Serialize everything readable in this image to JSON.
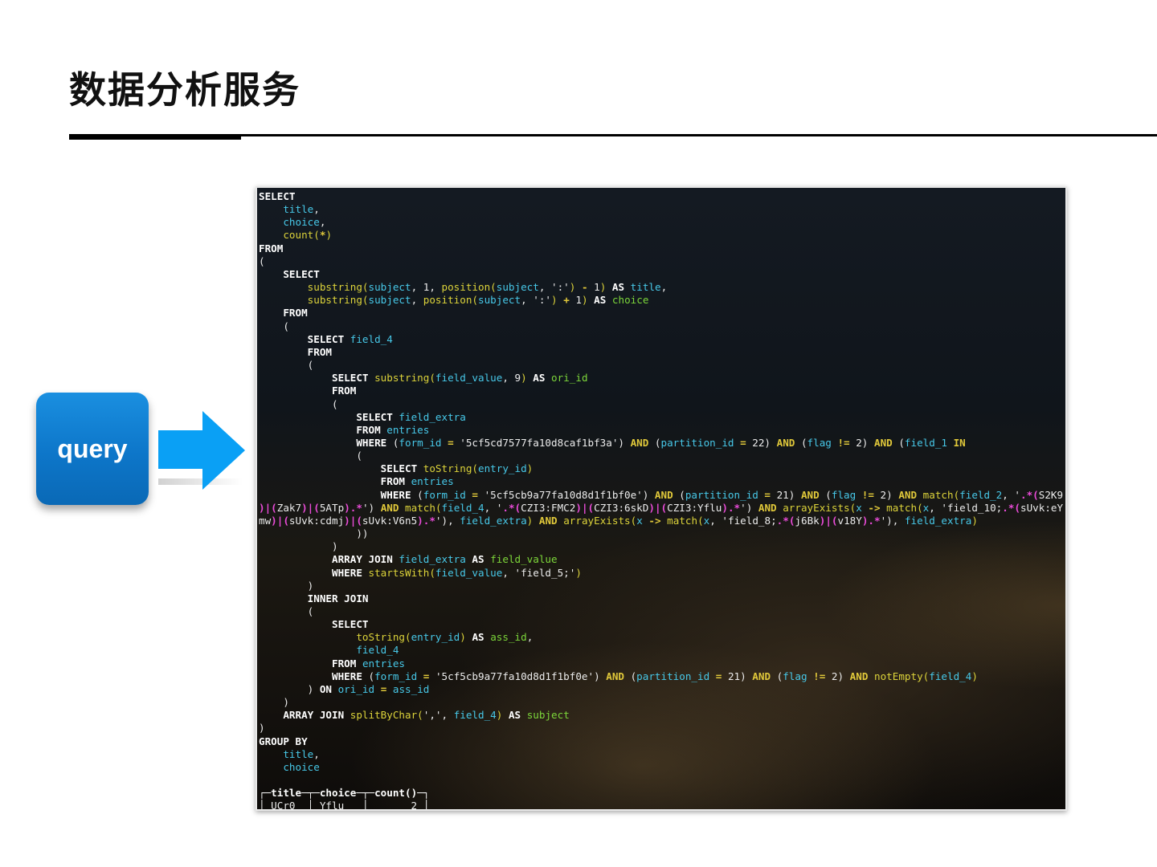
{
  "slide": {
    "title": "数据分析服务"
  },
  "badge": {
    "label": "query",
    "color": "#0d76c9"
  },
  "arrow": {
    "color": "#0aa0f5",
    "direction": "right"
  },
  "terminal": {
    "colors": {
      "keyword": "#ffffff",
      "identifier": "#47c8e8",
      "function": "#dcd33a",
      "alias": "#7cd63a",
      "operator": "#e0c83a",
      "regex": "#ea4bd8"
    },
    "lines": [
      [
        [
          "k",
          "SELECT"
        ]
      ],
      [
        [
          "w",
          "    "
        ],
        [
          "c",
          "title"
        ],
        [
          "w",
          ","
        ]
      ],
      [
        [
          "w",
          "    "
        ],
        [
          "c",
          "choice"
        ],
        [
          "w",
          ","
        ]
      ],
      [
        [
          "w",
          "    "
        ],
        [
          "f",
          "count("
        ],
        [
          "o",
          "*"
        ],
        [
          "f",
          ")"
        ]
      ],
      [
        [
          "k",
          "FROM"
        ]
      ],
      [
        [
          "w",
          "("
        ]
      ],
      [
        [
          "w",
          "    "
        ],
        [
          "k",
          "SELECT"
        ]
      ],
      [
        [
          "w",
          "        "
        ],
        [
          "f",
          "substring("
        ],
        [
          "c",
          "subject"
        ],
        [
          "w",
          ", 1, "
        ],
        [
          "f",
          "position("
        ],
        [
          "c",
          "subject"
        ],
        [
          "w",
          ", ':'"
        ],
        [
          "f",
          ")"
        ],
        [
          "w",
          " "
        ],
        [
          "o",
          "-"
        ],
        [
          "w",
          " 1"
        ],
        [
          "f",
          ")"
        ],
        [
          "w",
          " "
        ],
        [
          "k",
          "AS"
        ],
        [
          "w",
          " "
        ],
        [
          "c",
          "title"
        ],
        [
          "w",
          ","
        ]
      ],
      [
        [
          "w",
          "        "
        ],
        [
          "f",
          "substring("
        ],
        [
          "c",
          "subject"
        ],
        [
          "w",
          ", "
        ],
        [
          "f",
          "position("
        ],
        [
          "c",
          "subject"
        ],
        [
          "w",
          ", ':'"
        ],
        [
          "f",
          ")"
        ],
        [
          "w",
          " "
        ],
        [
          "o",
          "+"
        ],
        [
          "w",
          " 1"
        ],
        [
          "f",
          ")"
        ],
        [
          "w",
          " "
        ],
        [
          "k",
          "AS"
        ],
        [
          "w",
          " "
        ],
        [
          "g",
          "choice"
        ]
      ],
      [
        [
          "w",
          "    "
        ],
        [
          "k",
          "FROM"
        ]
      ],
      [
        [
          "w",
          "    ("
        ]
      ],
      [
        [
          "w",
          "        "
        ],
        [
          "k",
          "SELECT"
        ],
        [
          "w",
          " "
        ],
        [
          "c",
          "field_4"
        ]
      ],
      [
        [
          "w",
          "        "
        ],
        [
          "k",
          "FROM"
        ]
      ],
      [
        [
          "w",
          "        ("
        ]
      ],
      [
        [
          "w",
          "            "
        ],
        [
          "k",
          "SELECT"
        ],
        [
          "w",
          " "
        ],
        [
          "f",
          "substring("
        ],
        [
          "c",
          "field_value"
        ],
        [
          "w",
          ", 9"
        ],
        [
          "f",
          ")"
        ],
        [
          "w",
          " "
        ],
        [
          "k",
          "AS"
        ],
        [
          "w",
          " "
        ],
        [
          "g",
          "ori_id"
        ]
      ],
      [
        [
          "w",
          "            "
        ],
        [
          "k",
          "FROM"
        ]
      ],
      [
        [
          "w",
          "            ("
        ]
      ],
      [
        [
          "w",
          "                "
        ],
        [
          "k",
          "SELECT"
        ],
        [
          "w",
          " "
        ],
        [
          "c",
          "field_extra"
        ]
      ],
      [
        [
          "w",
          "                "
        ],
        [
          "k",
          "FROM"
        ],
        [
          "w",
          " "
        ],
        [
          "c",
          "entries"
        ]
      ],
      [
        [
          "w",
          "                "
        ],
        [
          "k",
          "WHERE"
        ],
        [
          "w",
          " ("
        ],
        [
          "c",
          "form_id"
        ],
        [
          "w",
          " "
        ],
        [
          "o",
          "="
        ],
        [
          "w",
          " '5cf5cd7577fa10d8caf1bf3a') "
        ],
        [
          "o",
          "AND"
        ],
        [
          "w",
          " ("
        ],
        [
          "c",
          "partition_id"
        ],
        [
          "w",
          " "
        ],
        [
          "o",
          "="
        ],
        [
          "w",
          " 22) "
        ],
        [
          "o",
          "AND"
        ],
        [
          "w",
          " ("
        ],
        [
          "c",
          "flag"
        ],
        [
          "w",
          " "
        ],
        [
          "o",
          "!="
        ],
        [
          "w",
          " 2) "
        ],
        [
          "o",
          "AND"
        ],
        [
          "w",
          " ("
        ],
        [
          "c",
          "field_1"
        ],
        [
          "w",
          " "
        ],
        [
          "o",
          "IN"
        ]
      ],
      [
        [
          "w",
          "                ("
        ]
      ],
      [
        [
          "w",
          "                    "
        ],
        [
          "k",
          "SELECT"
        ],
        [
          "w",
          " "
        ],
        [
          "f",
          "toString("
        ],
        [
          "c",
          "entry_id"
        ],
        [
          "f",
          ")"
        ]
      ],
      [
        [
          "w",
          "                    "
        ],
        [
          "k",
          "FROM"
        ],
        [
          "w",
          " "
        ],
        [
          "c",
          "entries"
        ]
      ],
      [
        [
          "w",
          "                    "
        ],
        [
          "k",
          "WHERE"
        ],
        [
          "w",
          " ("
        ],
        [
          "c",
          "form_id"
        ],
        [
          "w",
          " "
        ],
        [
          "o",
          "="
        ],
        [
          "w",
          " '5cf5cb9a77fa10d8d1f1bf0e') "
        ],
        [
          "o",
          "AND"
        ],
        [
          "w",
          " ("
        ],
        [
          "c",
          "partition_id"
        ],
        [
          "w",
          " "
        ],
        [
          "o",
          "="
        ],
        [
          "w",
          " 21) "
        ],
        [
          "o",
          "AND"
        ],
        [
          "w",
          " ("
        ],
        [
          "c",
          "flag"
        ],
        [
          "w",
          " "
        ],
        [
          "o",
          "!="
        ],
        [
          "w",
          " 2) "
        ],
        [
          "o",
          "AND"
        ],
        [
          "w",
          " "
        ],
        [
          "f",
          "match("
        ],
        [
          "c",
          "field_2"
        ],
        [
          "w",
          ", '"
        ],
        [
          "m",
          ".*("
        ],
        [
          "w",
          "S2K9"
        ]
      ],
      [
        [
          "m",
          ")|("
        ],
        [
          "w",
          "Zak7"
        ],
        [
          "m",
          ")|("
        ],
        [
          "w",
          "5ATp"
        ],
        [
          "m",
          ").*"
        ],
        [
          "w",
          "') "
        ],
        [
          "o",
          "AND"
        ],
        [
          "w",
          " "
        ],
        [
          "f",
          "match("
        ],
        [
          "c",
          "field_4"
        ],
        [
          "w",
          ", '"
        ],
        [
          "m",
          ".*("
        ],
        [
          "w",
          "CZI3:FMC2"
        ],
        [
          "m",
          ")|("
        ],
        [
          "w",
          "CZI3:6skD"
        ],
        [
          "m",
          ")|("
        ],
        [
          "w",
          "CZI3:Yflu"
        ],
        [
          "m",
          ").*"
        ],
        [
          "w",
          "') "
        ],
        [
          "o",
          "AND"
        ],
        [
          "w",
          " "
        ],
        [
          "f",
          "arrayExists("
        ],
        [
          "c",
          "x"
        ],
        [
          "w",
          " "
        ],
        [
          "o",
          "->"
        ],
        [
          "w",
          " "
        ],
        [
          "f",
          "match("
        ],
        [
          "c",
          "x"
        ],
        [
          "w",
          ", 'field_10;"
        ],
        [
          "m",
          ".*("
        ],
        [
          "w",
          "sUvk:eY"
        ]
      ],
      [
        [
          "w",
          "mw"
        ],
        [
          "m",
          ")|("
        ],
        [
          "w",
          "sUvk:cdmj"
        ],
        [
          "m",
          ")|("
        ],
        [
          "w",
          "sUvk:V6n5"
        ],
        [
          "m",
          ").*"
        ],
        [
          "w",
          "'), "
        ],
        [
          "c",
          "field_extra"
        ],
        [
          "f",
          ")"
        ],
        [
          "w",
          " "
        ],
        [
          "o",
          "AND"
        ],
        [
          "w",
          " "
        ],
        [
          "f",
          "arrayExists("
        ],
        [
          "c",
          "x"
        ],
        [
          "w",
          " "
        ],
        [
          "o",
          "->"
        ],
        [
          "w",
          " "
        ],
        [
          "f",
          "match("
        ],
        [
          "c",
          "x"
        ],
        [
          "w",
          ", 'field_8;"
        ],
        [
          "m",
          ".*("
        ],
        [
          "w",
          "j6Bk"
        ],
        [
          "m",
          ")|("
        ],
        [
          "w",
          "v18Y"
        ],
        [
          "m",
          ").*"
        ],
        [
          "w",
          "'), "
        ],
        [
          "c",
          "field_extra"
        ],
        [
          "f",
          ")"
        ]
      ],
      [
        [
          "w",
          "                ))"
        ]
      ],
      [
        [
          "w",
          "            )"
        ]
      ],
      [
        [
          "w",
          "            "
        ],
        [
          "k",
          "ARRAY JOIN"
        ],
        [
          "w",
          " "
        ],
        [
          "c",
          "field_extra"
        ],
        [
          "w",
          " "
        ],
        [
          "k",
          "AS"
        ],
        [
          "w",
          " "
        ],
        [
          "g",
          "field_value"
        ]
      ],
      [
        [
          "w",
          "            "
        ],
        [
          "k",
          "WHERE"
        ],
        [
          "w",
          " "
        ],
        [
          "f",
          "startsWith("
        ],
        [
          "c",
          "field_value"
        ],
        [
          "w",
          ", 'field_5;'"
        ],
        [
          "f",
          ")"
        ]
      ],
      [
        [
          "w",
          "        )"
        ]
      ],
      [
        [
          "w",
          "        "
        ],
        [
          "k",
          "INNER JOIN"
        ]
      ],
      [
        [
          "w",
          "        ("
        ]
      ],
      [
        [
          "w",
          "            "
        ],
        [
          "k",
          "SELECT"
        ]
      ],
      [
        [
          "w",
          "                "
        ],
        [
          "f",
          "toString("
        ],
        [
          "c",
          "entry_id"
        ],
        [
          "f",
          ")"
        ],
        [
          "w",
          " "
        ],
        [
          "k",
          "AS"
        ],
        [
          "w",
          " "
        ],
        [
          "g",
          "ass_id"
        ],
        [
          "w",
          ","
        ]
      ],
      [
        [
          "w",
          "                "
        ],
        [
          "c",
          "field_4"
        ]
      ],
      [
        [
          "w",
          "            "
        ],
        [
          "k",
          "FROM"
        ],
        [
          "w",
          " "
        ],
        [
          "c",
          "entries"
        ]
      ],
      [
        [
          "w",
          "            "
        ],
        [
          "k",
          "WHERE"
        ],
        [
          "w",
          " ("
        ],
        [
          "c",
          "form_id"
        ],
        [
          "w",
          " "
        ],
        [
          "o",
          "="
        ],
        [
          "w",
          " '5cf5cb9a77fa10d8d1f1bf0e') "
        ],
        [
          "o",
          "AND"
        ],
        [
          "w",
          " ("
        ],
        [
          "c",
          "partition_id"
        ],
        [
          "w",
          " "
        ],
        [
          "o",
          "="
        ],
        [
          "w",
          " 21) "
        ],
        [
          "o",
          "AND"
        ],
        [
          "w",
          " ("
        ],
        [
          "c",
          "flag"
        ],
        [
          "w",
          " "
        ],
        [
          "o",
          "!="
        ],
        [
          "w",
          " 2) "
        ],
        [
          "o",
          "AND"
        ],
        [
          "w",
          " "
        ],
        [
          "f",
          "notEmpty("
        ],
        [
          "c",
          "field_4"
        ],
        [
          "f",
          ")"
        ]
      ],
      [
        [
          "w",
          "        ) "
        ],
        [
          "k",
          "ON"
        ],
        [
          "w",
          " "
        ],
        [
          "c",
          "ori_id"
        ],
        [
          "w",
          " "
        ],
        [
          "o",
          "="
        ],
        [
          "w",
          " "
        ],
        [
          "c",
          "ass_id"
        ]
      ],
      [
        [
          "w",
          "    )"
        ]
      ],
      [
        [
          "w",
          "    "
        ],
        [
          "k",
          "ARRAY JOIN"
        ],
        [
          "w",
          " "
        ],
        [
          "f",
          "splitByChar("
        ],
        [
          "w",
          "',', "
        ],
        [
          "c",
          "field_4"
        ],
        [
          "f",
          ")"
        ],
        [
          "w",
          " "
        ],
        [
          "k",
          "AS"
        ],
        [
          "w",
          " "
        ],
        [
          "g",
          "subject"
        ]
      ],
      [
        [
          "w",
          ")"
        ]
      ],
      [
        [
          "k",
          "GROUP BY"
        ]
      ],
      [
        [
          "w",
          "    "
        ],
        [
          "c",
          "title"
        ],
        [
          "w",
          ","
        ]
      ],
      [
        [
          "w",
          "    "
        ],
        [
          "c",
          "choice"
        ]
      ],
      [
        [
          "w",
          ""
        ]
      ],
      [
        [
          "w",
          "┌─"
        ],
        [
          "b",
          "title"
        ],
        [
          "w",
          "─┬─"
        ],
        [
          "b",
          "choice"
        ],
        [
          "w",
          "─┬─"
        ],
        [
          "b",
          "count()"
        ],
        [
          "w",
          "─┐"
        ]
      ],
      [
        [
          "w",
          "│ UCr0  │ Yflu   │       2 │"
        ]
      ]
    ]
  }
}
